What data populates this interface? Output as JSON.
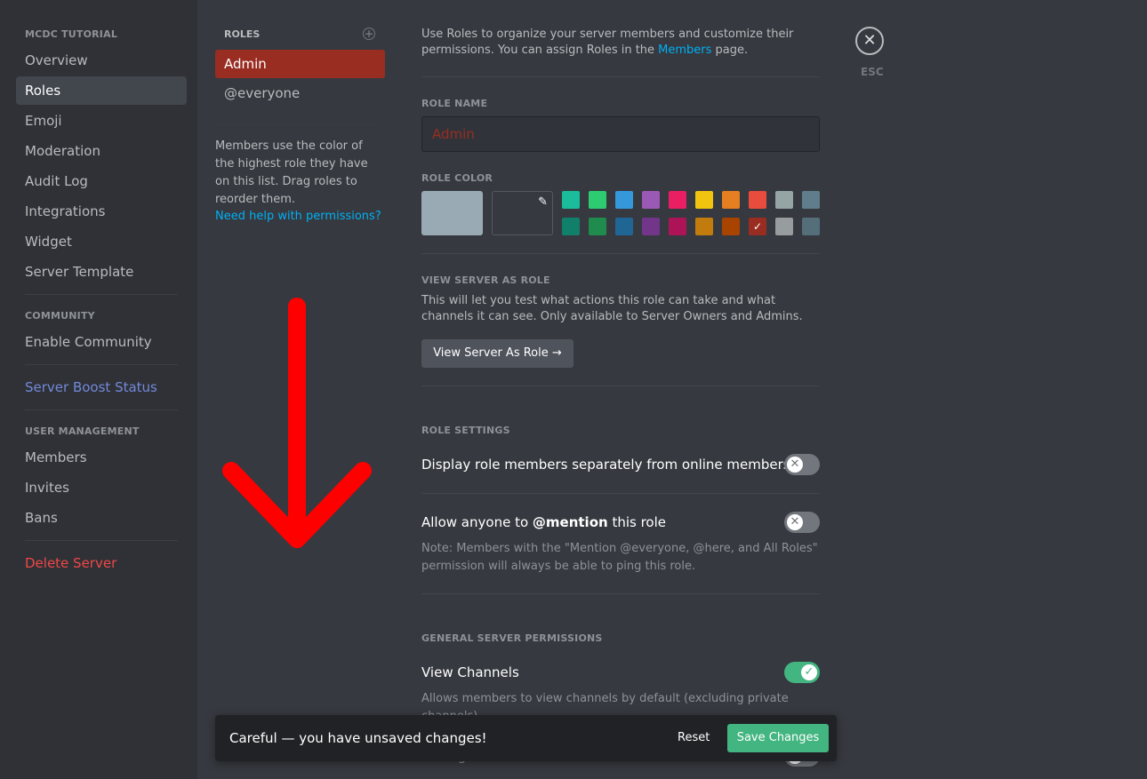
{
  "sidebar": {
    "server_header": "MCDC TUTORIAL",
    "items": [
      {
        "label": "Overview"
      },
      {
        "label": "Roles"
      },
      {
        "label": "Emoji"
      },
      {
        "label": "Moderation"
      },
      {
        "label": "Audit Log"
      },
      {
        "label": "Integrations"
      },
      {
        "label": "Widget"
      },
      {
        "label": "Server Template"
      }
    ],
    "community_header": "COMMUNITY",
    "enable_community": "Enable Community",
    "boost_status": "Server Boost Status",
    "user_mgmt_header": "USER MANAGEMENT",
    "user_items": [
      {
        "label": "Members"
      },
      {
        "label": "Invites"
      },
      {
        "label": "Bans"
      }
    ],
    "delete_server": "Delete Server"
  },
  "roles": {
    "header": "ROLES",
    "list": [
      {
        "name": "Admin"
      },
      {
        "name": "@everyone"
      }
    ],
    "info": "Members use the color of the highest role they have on this list. Drag roles to reorder them.",
    "help_link": "Need help with permissions?"
  },
  "main": {
    "intro_part1": "Use Roles to organize your server members and customize their permissions. You can assign Roles in the ",
    "intro_link": "Members",
    "intro_part2": " page.",
    "role_name_label": "ROLE NAME",
    "role_name_value": "Admin",
    "role_color_label": "ROLE COLOR",
    "view_as_role_label": "VIEW SERVER AS ROLE",
    "view_as_role_desc": "This will let you test what actions this role can take and what channels it can see. Only available to Server Owners and Admins.",
    "view_as_role_button": "View Server As Role",
    "role_settings_label": "ROLE SETTINGS",
    "setting_display_separately": "Display role members separately from online members",
    "setting_mention_prefix": "Allow anyone to ",
    "setting_mention_bold": "@mention",
    "setting_mention_suffix": " this role",
    "setting_mention_note": "Note: Members with the \"Mention @everyone, @here, and All Roles\" permission will always be able to ping this role.",
    "general_permissions_label": "GENERAL SERVER PERMISSIONS",
    "perm_view_channels": "View Channels",
    "perm_view_channels_desc": "Allows members to view channels by default (excluding private channels).",
    "perm_manage_channels": "Manage Channels"
  },
  "colors": {
    "accent": "#992d22",
    "default_swatch": "#99aab5",
    "row1": [
      "#1abc9c",
      "#2ecc71",
      "#3498db",
      "#9b59b6",
      "#e91e63",
      "#f1c40f",
      "#e67e22",
      "#e74c3c",
      "#95a5a6",
      "#607d8b"
    ],
    "row2": [
      "#11806a",
      "#1f8b4c",
      "#206694",
      "#71368a",
      "#ad1457",
      "#c27c0e",
      "#a84300",
      "#992d22",
      "#979c9f",
      "#546e7a"
    ],
    "selected_index_row2": 7
  },
  "toggles": {
    "display_separately": false,
    "mention": false,
    "view_channels": true,
    "manage_channels": false
  },
  "close": {
    "label": "ESC",
    "icon": "close-icon"
  },
  "notice": {
    "text": "Careful — you have unsaved changes!",
    "reset": "Reset",
    "save": "Save Changes"
  }
}
